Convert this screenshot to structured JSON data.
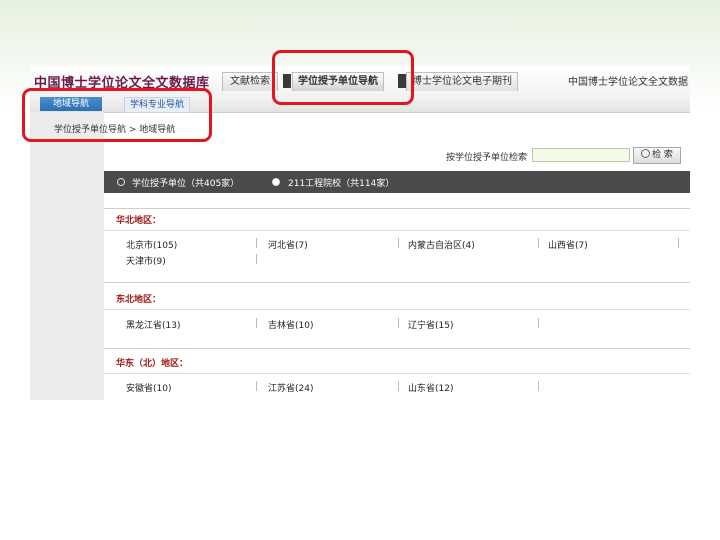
{
  "header": {
    "logo": "中国博士学位论文全文数据库",
    "tabs": [
      {
        "label": "文献检索",
        "active": false
      },
      {
        "label": "学位授予单位导航",
        "active": true
      },
      {
        "label": "博士学位论文电子期刊",
        "active": false
      }
    ],
    "site_right": "中国博士学位论文全文数据"
  },
  "subnav": {
    "tabs": [
      {
        "label": "地域导航",
        "active": true
      },
      {
        "label": "学科专业导航",
        "active": false
      }
    ]
  },
  "breadcrumb": "学位授予单位导航 > 地域导航",
  "search": {
    "label": "按学位授予单位检索",
    "value": "",
    "button_label": "检 索"
  },
  "filter": {
    "options": [
      {
        "label": "学位授予单位（共405家）",
        "checked": false
      },
      {
        "label": "211工程院校（共114家）",
        "checked": true
      }
    ]
  },
  "regions": [
    {
      "name": "华北地区：",
      "rows": [
        [
          "北京市(105)",
          "河北省(7)",
          "内蒙古自治区(4)",
          "山西省(7)"
        ],
        [
          "天津市(9)"
        ]
      ]
    },
    {
      "name": "东北地区：",
      "rows": [
        [
          "黑龙江省(13)",
          "吉林省(10)",
          "辽宁省(15)"
        ]
      ]
    },
    {
      "name": "华东（北）地区：",
      "rows": [
        [
          "安徽省(10)",
          "江苏省(24)",
          "山东省(12)"
        ]
      ]
    }
  ],
  "colors": {
    "annotation_red": "#e3161f",
    "filter_bar": "#4a4a4a",
    "region_heading": "#9a1818",
    "active_subtab": "#2c6fb3"
  }
}
